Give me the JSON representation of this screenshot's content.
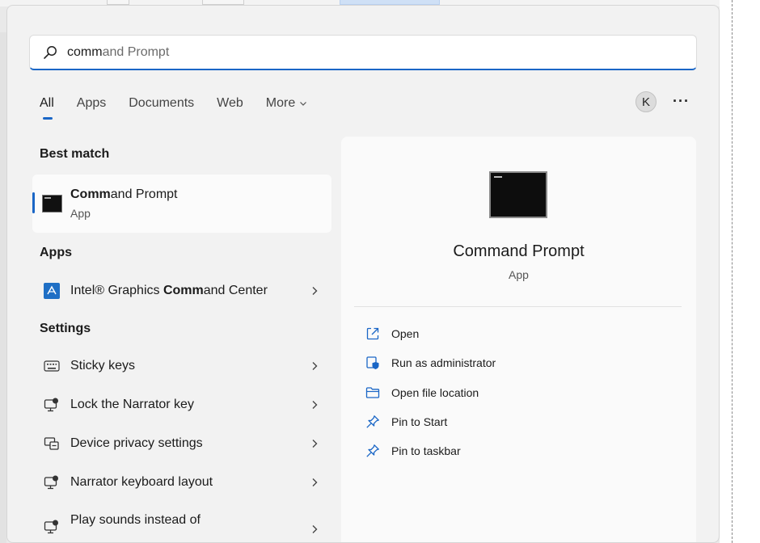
{
  "search": {
    "typed": "comm",
    "rest": "and Prompt"
  },
  "tabs": [
    {
      "label": "All",
      "active": true
    },
    {
      "label": "Apps"
    },
    {
      "label": "Documents"
    },
    {
      "label": "Web"
    },
    {
      "label": "More"
    }
  ],
  "account": {
    "initial": "K"
  },
  "more_options_glyph": "···",
  "best_match": {
    "section_title": "Best match",
    "name_bold": "Comm",
    "name_rest": "and Prompt",
    "type": "App"
  },
  "apps": {
    "section_title": "Apps",
    "items": [
      {
        "pre": "Intel® Graphics ",
        "bold": "Comm",
        "post": "and Center"
      }
    ]
  },
  "settings": {
    "section_title": "Settings",
    "items": [
      {
        "label": "Sticky keys"
      },
      {
        "label": "Lock the Narrator key"
      },
      {
        "label": "Device privacy settings"
      },
      {
        "label": "Narrator keyboard layout"
      },
      {
        "label": "Play sounds instead of"
      }
    ]
  },
  "preview": {
    "title": "Command Prompt",
    "type": "App",
    "actions": [
      {
        "label": "Open"
      },
      {
        "label": "Run as administrator"
      },
      {
        "label": "Open file location"
      },
      {
        "label": "Pin to Start"
      },
      {
        "label": "Pin to taskbar"
      }
    ]
  },
  "colors": {
    "accent": "#1a66c6",
    "panel": "#f2f2f2",
    "card": "#fbfbfb"
  }
}
